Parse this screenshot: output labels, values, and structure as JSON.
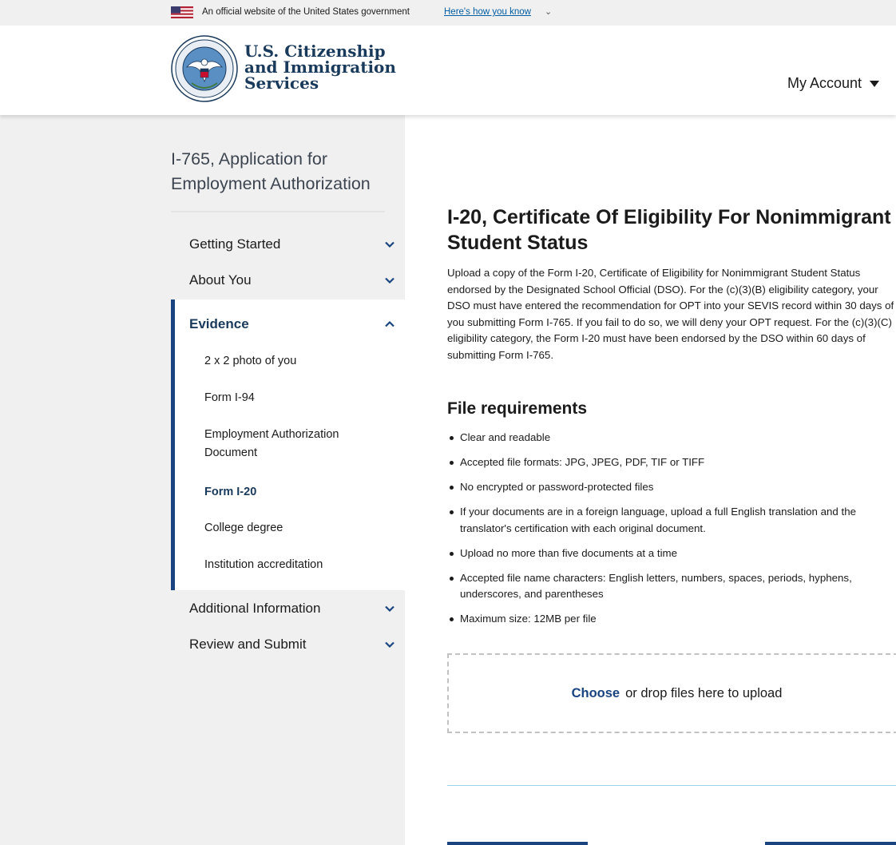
{
  "gov_banner": {
    "text": "An official website of the United States government",
    "link": "Here's how you know",
    "flag_icon": "us-flag-icon"
  },
  "header": {
    "brand_lines": [
      "U.S. Citizenship",
      "and Immigration",
      "Services"
    ],
    "account_label": "My Account"
  },
  "sidebar": {
    "title": "I-765, Application for Employment Authorization",
    "sections": [
      {
        "label": "Getting Started",
        "expanded": false
      },
      {
        "label": "About You",
        "expanded": false
      },
      {
        "label": "Evidence",
        "expanded": true
      },
      {
        "label": "Additional Information",
        "expanded": false
      },
      {
        "label": "Review and Submit",
        "expanded": false
      }
    ],
    "evidence_items": [
      "2 x 2 photo of you",
      "Form I-94",
      "Employment Authorization Document",
      "Form I-20",
      "College degree",
      "Institution accreditation"
    ],
    "current_item": "Form I-20"
  },
  "main": {
    "title": "I-20, Certificate Of Eligibility For Nonimmigrant Student Status",
    "intro": "Upload a copy of the Form I-20, Certificate of Eligibility for Nonimmigrant Student Status endorsed by the Designated School Official (DSO). For the (c)(3)(B) eligibility category, your DSO must have entered the recommendation for OPT into your SEVIS record within 30 days of you submitting Form I-765. If you fail to do so, we will deny your OPT request. For the (c)(3)(C) eligibility category, the Form I-20 must have been endorsed by the DSO within 60 days of submitting Form I-765.",
    "requirements_title": "File requirements",
    "requirements": [
      "Clear and readable",
      "Accepted file formats: JPG, JPEG, PDF, TIF or TIFF",
      "No encrypted or password-protected files",
      "If your documents are in a foreign language, upload a full English translation and the translator's certification with each original document.",
      "Upload no more than five documents at a time",
      "Accepted file name characters: English letters, numbers, spaces, periods, hyphens, underscores, and parentheses",
      "Maximum size: 12MB per file"
    ],
    "upload": {
      "choose": "Choose",
      "rest": "or drop files here to upload"
    }
  },
  "colors": {
    "brand_navy": "#1a4480",
    "link_blue": "#005ea2",
    "sidebar_bg": "#f0f0f0"
  }
}
